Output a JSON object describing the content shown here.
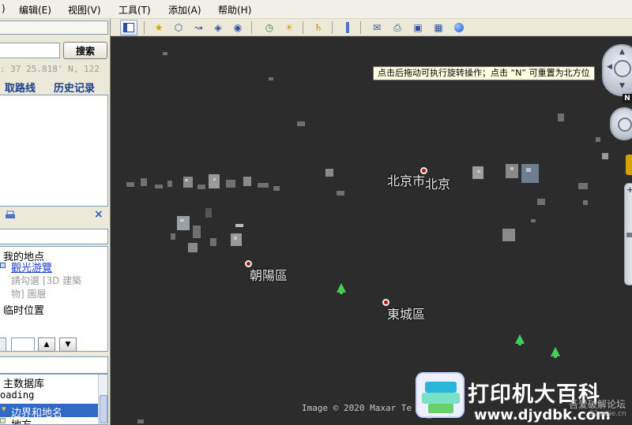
{
  "menu": {
    "paren": ")",
    "edit": "编辑(E)",
    "view": "视图(V)",
    "tools": "工具(T)",
    "add": "添加(A)",
    "help": "帮助(H)"
  },
  "search": {
    "button_label": "搜索",
    "coords": ": 37 25.818' N, 122",
    "tab_directions": "取路线",
    "tab_history": "历史记录"
  },
  "places": {
    "my_places": "我的地点",
    "tour": "觀光游覽",
    "hint_line1": "請勾選 [3D 建築",
    "hint_line2": "物] 圖層",
    "temp": "临时位置"
  },
  "layers": {
    "primary_db": "主数据库",
    "loading": "oading",
    "borders": "边界和地名",
    "next_item": "地方"
  },
  "tooltip": "点击后拖动可执行旋转操作；点击 “N” 可重置为北方位",
  "map_labels": {
    "beijing_city": "北京市",
    "beijing": "北京",
    "chaoyang": "朝陽區",
    "dongcheng": "東城區"
  },
  "nav": {
    "north": "N"
  },
  "attribution": "Image © 2020 Maxar Te",
  "watermark": {
    "title": "打印机大百科",
    "url": "www.djydbk.com",
    "forum": "吾爱破解论坛",
    "forum_url": "52pojie.cn"
  },
  "icons": {
    "sidebar_toggle": "sidebar-toggle-icon",
    "placemark": "placemark-icon",
    "polygon": "polygon-icon",
    "path": "path-icon",
    "overlay": "image-overlay-icon",
    "record": "record-tour-icon",
    "history": "historical-imagery-icon",
    "sun": "sunlight-icon",
    "planets": "planets-icon",
    "ruler": "ruler-icon",
    "email": "email-icon",
    "print": "print-icon",
    "save_image": "save-image-icon",
    "maps": "view-in-maps-icon",
    "earth": "earth-icon"
  }
}
